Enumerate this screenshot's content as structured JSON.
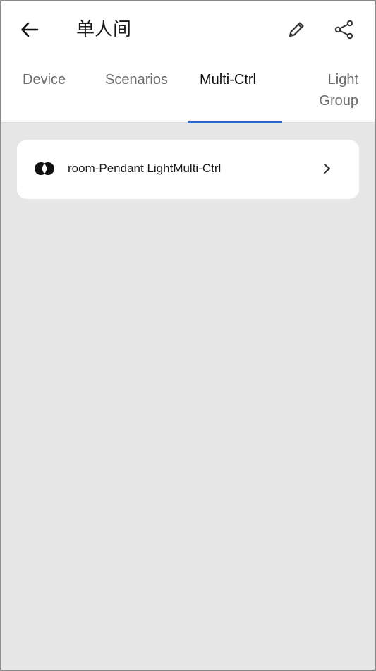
{
  "header": {
    "title": "单人间",
    "back_icon": "arrow-left-icon",
    "edit_icon": "pencil-icon",
    "share_icon": "share-icon"
  },
  "tabs": [
    {
      "label": "Device",
      "active": false
    },
    {
      "label": "Scenarios",
      "active": false
    },
    {
      "label": "Multi-Ctrl",
      "active": true
    },
    {
      "label_line1": "Light",
      "label_line2": "Group",
      "active": false
    }
  ],
  "colors": {
    "accent": "#2b66c9",
    "background": "#e6e6e6",
    "card": "#ffffff",
    "text": "#1a1a1a",
    "muted_text": "#6b6b6b"
  },
  "multi_ctrl_list": [
    {
      "label": "room-Pendant LightMulti-Ctrl",
      "icon": "multi-ctrl-icon",
      "trailing_icon": "chevron-right-icon"
    }
  ]
}
